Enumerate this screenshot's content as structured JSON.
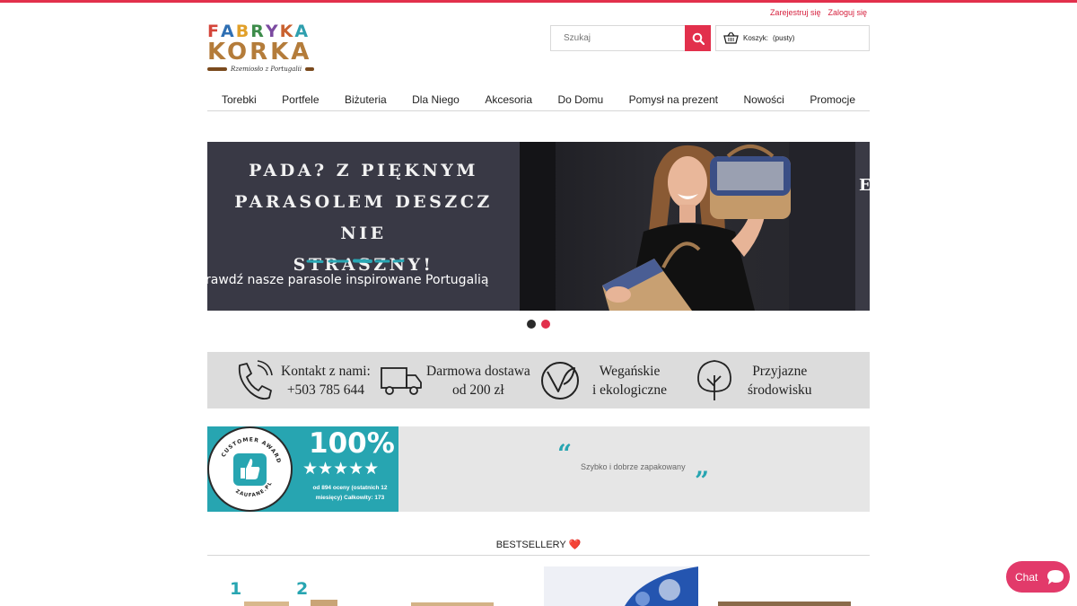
{
  "header": {
    "register_label": "Zarejestruj się",
    "login_label": "Zaloguj się",
    "logo": {
      "line1": "FABRYKA",
      "line2": "KORKA",
      "tagline": "Rzemiosło z Portugalii",
      "colors": [
        "#d4453a",
        "#2f6fb3",
        "#e1a02a",
        "#3d8c4a",
        "#7b4aa0",
        "#c9612f",
        "#2f9fae"
      ]
    },
    "search_placeholder": "Szukaj",
    "cart_label": "Koszyk:",
    "cart_status": "(pusty)"
  },
  "nav": {
    "items": [
      "Torebki",
      "Portfele",
      "Biżuteria",
      "Dla Niego",
      "Akcesoria",
      "Do Domu",
      "Pomysł na prezent",
      "Nowości",
      "Promocje"
    ]
  },
  "hero": {
    "headline_line1": "PADA? Z PIĘKNYM",
    "headline_line2": "PARASOLEM DESZCZ NIE",
    "headline_line3": "STRASZNY!",
    "subtitle": "rawdź nasze parasole inspirowane Portugalią",
    "next_slide_letter": "E",
    "dots_active_index": 1
  },
  "features": [
    {
      "line1": "Kontakt z nami:",
      "line2": "+503 785 644",
      "icon": "phone-icon"
    },
    {
      "line1": "Darmowa dostawa",
      "line2": "od 200 zł",
      "icon": "truck-icon"
    },
    {
      "line1": "Wegańskie",
      "line2": "i ekologiczne",
      "icon": "vegan-leaf-icon"
    },
    {
      "line1": "Przyjazne",
      "line2": "środowisku",
      "icon": "tree-icon"
    }
  ],
  "reviews": {
    "badge_title": "CUSTOMER AWARD",
    "badge_source": "ZAUFANE.PL",
    "percent": "100%",
    "stars": "★★★★★",
    "rating_count_line1": "od 894 oceny (ostatnich 12",
    "rating_count_line2": "miesięcy) Całkowity: 173",
    "quote": "Szybko i dobrze zapakowany"
  },
  "bestsellers": {
    "title": "BESTSELLERY",
    "heart": "❤️",
    "rank_labels": [
      "1",
      "2"
    ]
  },
  "chat": {
    "label": "Chat"
  },
  "colors": {
    "accent": "#e2304c",
    "teal": "#27a5b1",
    "chat": "#e23a6a",
    "feature_bg": "#dcdcdc",
    "review_bg": "#e6e6e6",
    "hero_panel": "#393945"
  }
}
